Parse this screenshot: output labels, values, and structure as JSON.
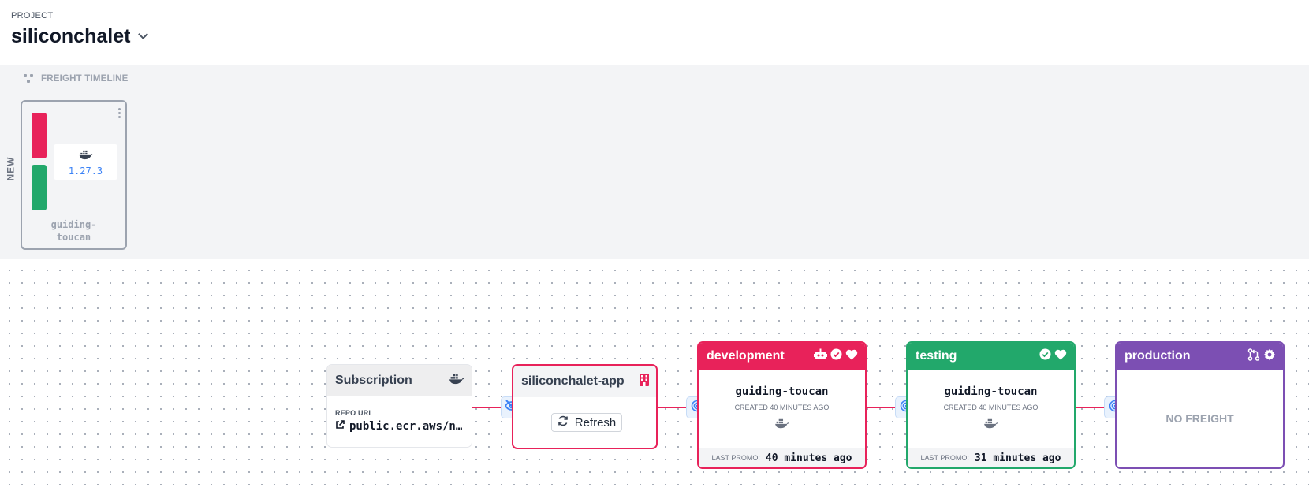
{
  "header": {
    "project_label": "PROJECT",
    "project_name": "siliconchalet"
  },
  "timeline": {
    "title": "FREIGHT TIMELINE",
    "new_label": "NEW",
    "freight": {
      "name": "guiding-\ntoucan",
      "image_version": "1.27.3",
      "stage_colors": [
        "#e8225a",
        "#22a86b"
      ]
    }
  },
  "graph": {
    "subscription": {
      "title": "Subscription",
      "repo_label": "REPO URL",
      "repo_url": "public.ecr.aws/n…"
    },
    "warehouse": {
      "name": "siliconchalet-app",
      "refresh_label": "Refresh"
    },
    "stages": [
      {
        "name": "development",
        "color": "#e8225a",
        "freight": "guiding-toucan",
        "created": "CREATED 40 MINUTES AGO",
        "promo_label": "LAST PROMO:",
        "promo_value": "40 minutes ago",
        "icons": [
          "robot-icon",
          "check-circle-icon",
          "heart-icon"
        ]
      },
      {
        "name": "testing",
        "color": "#22a86b",
        "freight": "guiding-toucan",
        "created": "CREATED 40 MINUTES AGO",
        "promo_label": "LAST PROMO:",
        "promo_value": "31 minutes ago",
        "icons": [
          "check-circle-icon",
          "heart-icon"
        ]
      },
      {
        "name": "production",
        "color": "#7c4fb3",
        "no_freight": "NO FREIGHT",
        "icons": [
          "git-pull-request-icon",
          "gear-icon"
        ]
      }
    ]
  }
}
